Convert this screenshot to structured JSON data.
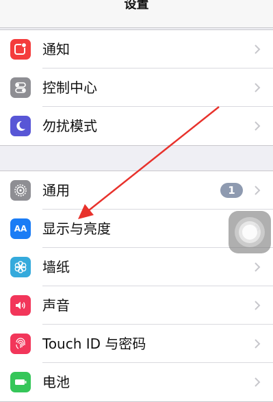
{
  "nav": {
    "title": "设置"
  },
  "group1": [
    {
      "label": "通知",
      "icon": "notifications-icon",
      "color": "#f43c3c"
    },
    {
      "label": "控制中心",
      "icon": "control-center-icon",
      "color": "#8e8e93"
    },
    {
      "label": "勿扰模式",
      "icon": "moon-icon",
      "color": "#5856d6"
    }
  ],
  "group2": [
    {
      "label": "通用",
      "icon": "gear-icon",
      "color": "#8e8e93",
      "badge": "1"
    },
    {
      "label": "显示与亮度",
      "icon": "display-brightness-icon",
      "color": "#1a7cf5"
    },
    {
      "label": "墙纸",
      "icon": "wallpaper-icon",
      "color": "#35aadc"
    },
    {
      "label": "声音",
      "icon": "speaker-icon",
      "color": "#f2365a"
    },
    {
      "label": "Touch ID 与密码",
      "icon": "fingerprint-icon",
      "color": "#f2365a"
    },
    {
      "label": "电池",
      "icon": "battery-icon",
      "color": "#35c659"
    }
  ],
  "icon_text": {
    "display": "AA"
  },
  "accent": {
    "arrow": "#e8322c"
  }
}
